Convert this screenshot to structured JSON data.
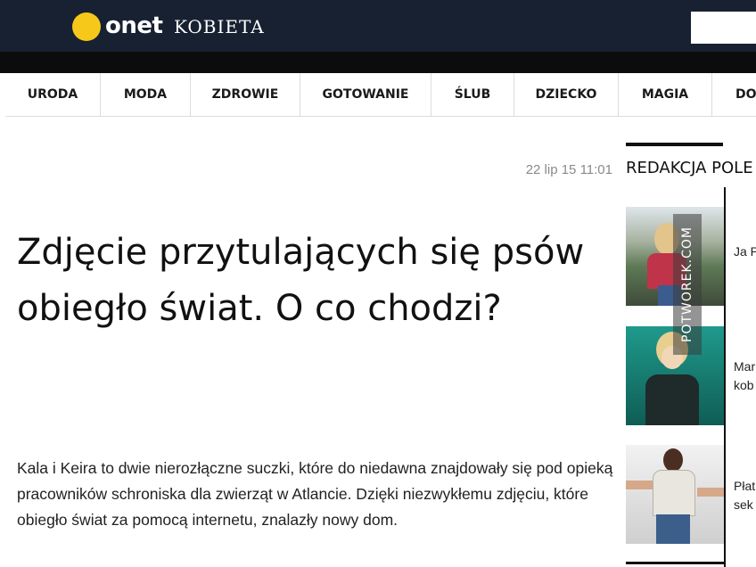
{
  "header": {
    "brand": "onet",
    "section": "KOBIETA",
    "colors": {
      "bar": "#172131",
      "logo_dot": "#f6c819"
    }
  },
  "nav": {
    "items": [
      {
        "label": "URODA"
      },
      {
        "label": "MODA"
      },
      {
        "label": "ZDROWIE"
      },
      {
        "label": "GOTOWANIE"
      },
      {
        "label": "ŚLUB"
      },
      {
        "label": "DZIECKO"
      },
      {
        "label": "MAGIA"
      },
      {
        "label": "DO"
      }
    ]
  },
  "article": {
    "date": "22 lip 15 11:01",
    "title": "Zdjęcie przytulających się psów obiegło świat. O co chodzi?",
    "lead": "Kala i Keira to dwie nierozłączne suczki, które do niedawna znajdowały się pod opieką pracowników schroniska dla zwierząt w Atlancie. Dzięki niezwykłemu zdjęciu, które obiegło świat za pomocą internetu, znalazły nowy dom."
  },
  "sidebar": {
    "heading": "REDAKCJA POLE",
    "items": [
      {
        "caption_lines": [
          "Ja P"
        ]
      },
      {
        "caption_lines": [
          "Mar",
          "kob"
        ]
      },
      {
        "caption_lines": [
          "Płat",
          "sek"
        ]
      }
    ]
  },
  "watermark": "POTWOREK.COM"
}
